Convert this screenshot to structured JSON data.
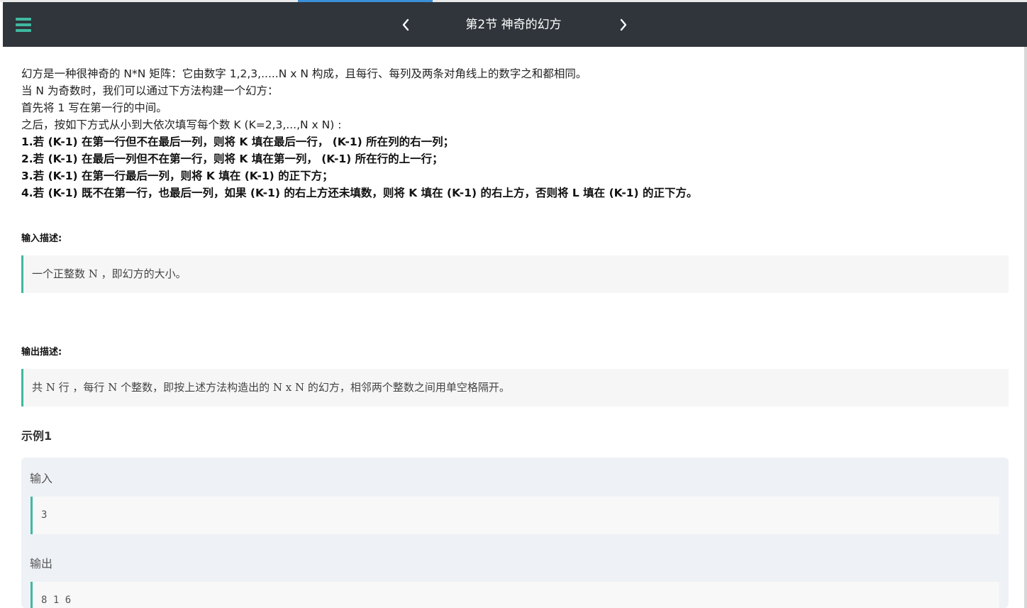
{
  "navbar": {
    "title": "第2节 神奇的幻方",
    "prev_icon": "chevron-left-icon",
    "next_icon": "chevron-right-icon",
    "menu_icon": "hamburger-menu-icon",
    "accent_color": "#3fb9a0",
    "background_color": "#2f353b"
  },
  "description": {
    "lines": [
      "幻方是一种很神奇的 N*N 矩阵：它由数字 1,2,3,.....N x N 构成，且每行、每列及两条对角线上的数字之和都相同。",
      "当 N 为奇数时，我们可以通过下方法构建一个幻方：",
      "首先将 1 写在第一行的中间。",
      "之后，按如下方式从小到大依次填写每个数 K (K=2,3,...,N x N) :"
    ],
    "rules": [
      "1.若 (K-1) 在第一行但不在最后一列，则将 K 填在最后一行， (K-1) 所在列的右一列；",
      "2.若 (K-1) 在最后一列但不在第一行，则将 K 填在第一列， (K-1) 所在行的上一行；",
      "3.若 (K-1) 在第一行最后一列，则将 K 填在 (K-1) 的正下方；",
      "4.若 (K-1) 既不在第一行，也最后一列，如果 (K-1) 的右上方还未填数，则将 K 填在 (K-1) 的右上方，否则将 L 填在 (K-1) 的正下方。"
    ]
  },
  "input_section": {
    "label": "输入描述:",
    "text": "一个正整数 N ，即幻方的大小。"
  },
  "output_section": {
    "label": "输出描述:",
    "text": "共 N 行 ，每行 N 个整数，即按上述方法构造出的 N x N 的幻方，相邻两个整数之间用单空格隔开。"
  },
  "example": {
    "title": "示例1",
    "input_label": "输入",
    "input_value": "3",
    "output_label": "输出",
    "output_value": "8 1 6"
  }
}
